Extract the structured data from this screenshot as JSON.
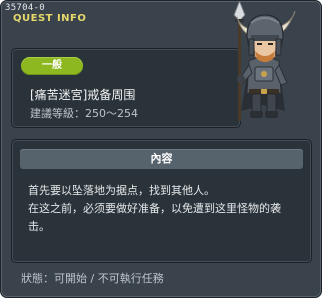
{
  "header": {
    "quest_id": "35704-0",
    "title": "QUEST INFO"
  },
  "quest": {
    "difficulty": "一般",
    "name": "[痛苦迷宮]戒备周围",
    "level": "建議等級：250～254"
  },
  "content": {
    "heading": "內容",
    "lines": [
      "首先要以坠落地为据点，找到其他人。",
      "在这之前，必须要做好准备，以免遭到这里怪物的袭击。"
    ]
  },
  "status": {
    "text": "狀態：可開始 / 不可執行任務"
  },
  "colors": {
    "window_bg": "#3a434c",
    "panel_bg": "#2b333a",
    "badge_green": "#8db81f",
    "title_yellow": "#e6d86a",
    "content_header_bg": "#56636d"
  },
  "icons": {
    "npc": "armored-knight-npc-portrait"
  }
}
